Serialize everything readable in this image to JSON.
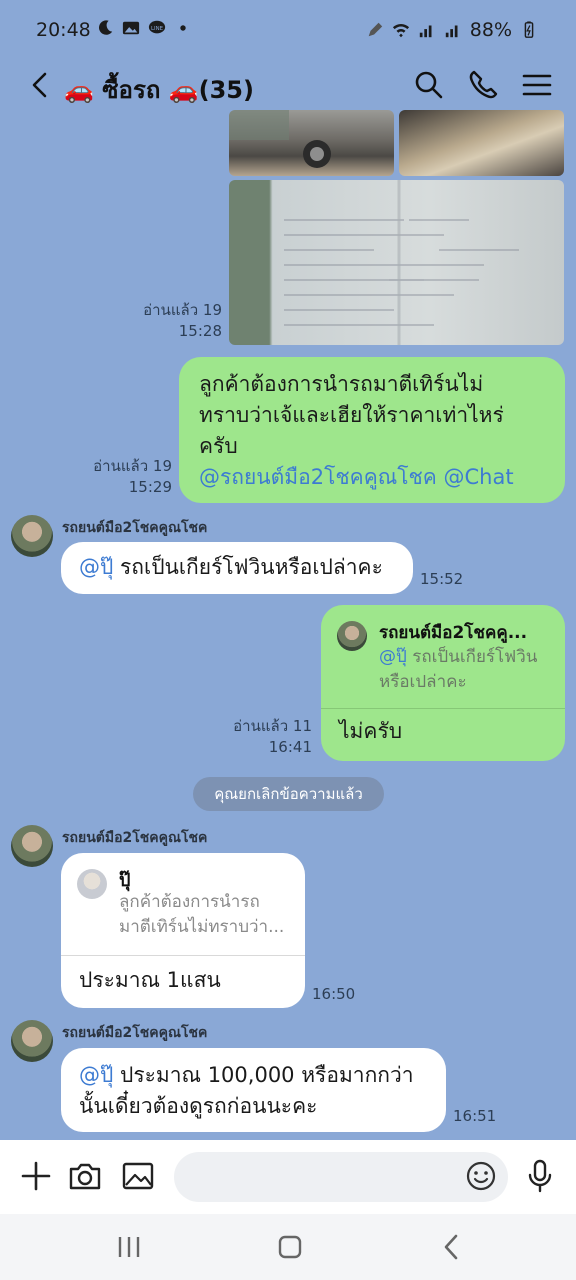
{
  "status": {
    "time": "20:48",
    "battery": "88%",
    "icons_left": [
      "moon-icon",
      "gallery-icon",
      "line-icon",
      "dot-icon"
    ],
    "icons_right": [
      "pen-icon",
      "wifi-icon",
      "signal-icon",
      "signal-icon",
      "battery-icon"
    ]
  },
  "header": {
    "title": "🚗 ซื้อรถ 🚗(35)",
    "icons": [
      "back-icon",
      "search-icon",
      "phone-icon",
      "menu-icon"
    ]
  },
  "messages": {
    "m1": {
      "read": "อ่านแล้ว 19",
      "time": "15:28"
    },
    "m2": {
      "text": "ลูกค้าต้องการนำรถมาตีเทิร์นไม่ทราบว่าเจ้และเฮียให้ราคาเท่าไหร่ครับ",
      "line1": "ลูกค้าต้องการนำรถมาตีเทิร์นไม่",
      "line2": "ทราบว่าเจ้และเฮียให้ราคาเท่าไหร่",
      "line3": "ครับ",
      "mention": "@รถยนต์มือ2โชคคูณโชค @Chat",
      "read": "อ่านแล้ว 19",
      "time": "15:29"
    },
    "m3": {
      "sender": "รถยนต์มือ2โชคคูณโชค",
      "mention": "@ปุ๊",
      "text": " รถเป็นเกียร์โฟวินหรือเปล่าคะ",
      "time": "15:52"
    },
    "m4": {
      "reply_sender": "รถยนต์มือ2โชคคู...",
      "reply_mention": "@ปุ๊",
      "reply_text1": " รถเป็นเกียร์โฟวิน",
      "reply_text2": "หรือเปล่าคะ",
      "text": "ไม่ครับ",
      "read": "อ่านแล้ว 11",
      "time": "16:41"
    },
    "system": "คุณยกเลิกข้อความแล้ว",
    "m5": {
      "sender": "รถยนต์มือ2โชคคูณโชค",
      "reply_name": "ปุ๊",
      "reply_text1": "ลูกค้าต้องการนำรถ",
      "reply_text2": "มาตีเทิร์นไม่ทราบว่า...",
      "text": "ประมาณ 1แสน",
      "time": "16:50"
    },
    "m6": {
      "sender": "รถยนต์มือ2โชคคูณโชค",
      "mention": "@ปุ๊",
      "line1": " ประมาณ 100,000 หรือมากกว่า",
      "line2": "นั้นเดี๋ยวต้องดูรถก่อนนะคะ",
      "time": "16:51"
    }
  },
  "composer": {
    "placeholder": "",
    "icons": [
      "plus-icon",
      "camera-icon",
      "image-icon",
      "emoji-icon",
      "mic-icon"
    ]
  },
  "navbar": {
    "icons": [
      "recents-icon",
      "home-icon",
      "back-icon"
    ]
  },
  "colors": {
    "background": "#8aa8d6",
    "my_bubble": "#9ee68c",
    "other_bubble": "#ffffff",
    "mention": "#3d7bd2"
  }
}
